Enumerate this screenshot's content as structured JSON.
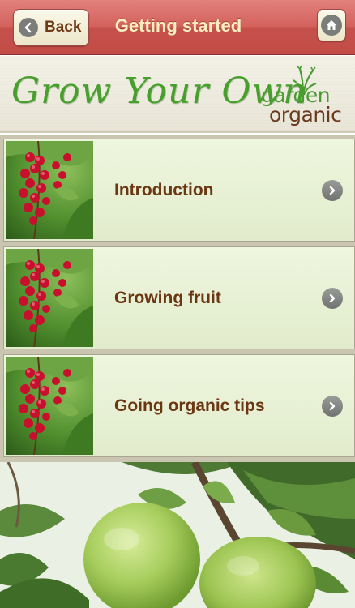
{
  "navbar": {
    "back_label": "Back",
    "title": "Getting started",
    "home_icon": "home-icon",
    "back_icon": "chevron-left-icon"
  },
  "banner": {
    "title": "Grow Your Own",
    "logo": {
      "line1": "garden",
      "line2": "organic"
    }
  },
  "menu": {
    "items": [
      {
        "label": "Introduction",
        "thumbnail": "redcurrant-photo",
        "chevron": "chevron-right-icon"
      },
      {
        "label": "Growing fruit",
        "thumbnail": "redcurrant-photo",
        "chevron": "chevron-right-icon"
      },
      {
        "label": "Going organic tips",
        "thumbnail": "redcurrant-photo",
        "chevron": "chevron-right-icon"
      }
    ]
  },
  "photo": {
    "subject": "green-apples-on-tree"
  },
  "colors": {
    "navbar_red": "#d4625d",
    "nav_title": "#fbeec0",
    "button_face": "#f6f2de",
    "label_brown": "#6b3612",
    "banner_green": "#48a02c",
    "row_bg": "#e8f0d6"
  }
}
